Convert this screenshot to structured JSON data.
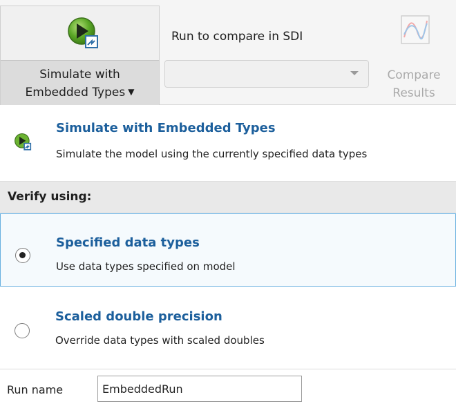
{
  "toolstrip": {
    "simulate_button": {
      "label_line1": "Simulate with",
      "label_line2": "Embedded Types",
      "icon": "run-embedded-icon"
    },
    "run_compare_label": "Run to compare in SDI",
    "run_select_value": "",
    "compare_button": {
      "label_line1": "Compare",
      "label_line2": "Results",
      "icon": "compare-results-icon",
      "enabled": false
    }
  },
  "description": {
    "title": "Simulate with Embedded Types",
    "subtitle": "Simulate the model using the currently specified data types"
  },
  "verify": {
    "header": "Verify using:",
    "options": [
      {
        "title": "Specified data types",
        "subtitle": "Use data types specified on model",
        "selected": true
      },
      {
        "title": "Scaled double precision",
        "subtitle": "Override data types with scaled doubles",
        "selected": false
      }
    ]
  },
  "run_name": {
    "label": "Run name",
    "value": "EmbeddedRun"
  },
  "colors": {
    "accent_blue": "#1c5f9c",
    "play_green": "#5aa726",
    "selected_border": "#66afe0"
  }
}
